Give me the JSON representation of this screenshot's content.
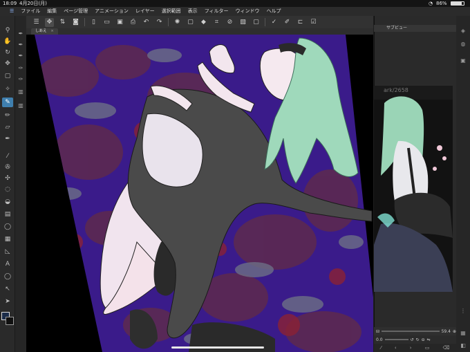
{
  "status": {
    "time": "18:09",
    "date": "4月20日(月)",
    "battery": "86%"
  },
  "menu": [
    "ファイル",
    "編集",
    "ページ管理",
    "アニメーション",
    "レイヤー",
    "選択範囲",
    "表示",
    "フィルター",
    "ウィンドウ",
    "ヘルプ"
  ],
  "document_tab": "しあえ",
  "panel": {
    "title": "サブビュー",
    "subview_watermark": "ark/2658"
  },
  "navigator": {
    "zoom": "59.4",
    "rotation": "0.0"
  },
  "colors": {
    "accent": "#3f7fae",
    "canvas_bg": "#000000",
    "hair": "#9fd9bb",
    "dress": "#4a4a4a",
    "pattern_purple": "#3f1d8c"
  }
}
